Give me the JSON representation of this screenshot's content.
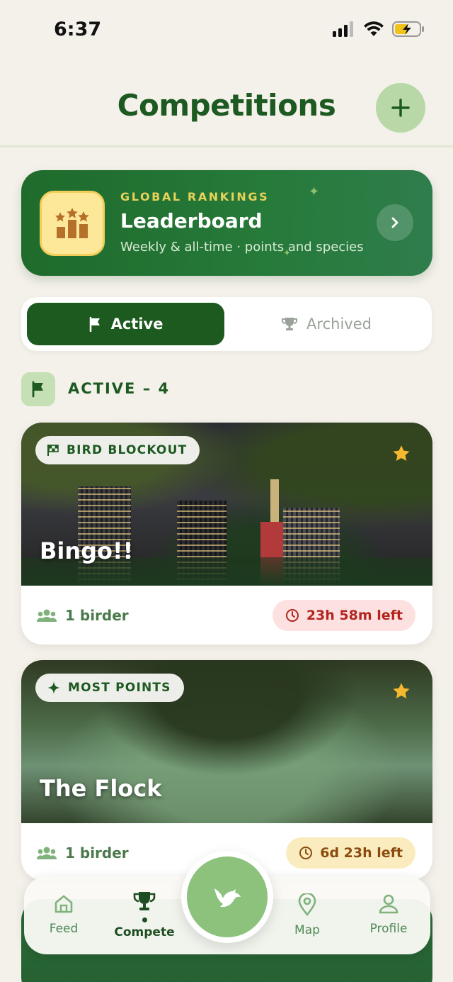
{
  "status_bar": {
    "time": "6:37"
  },
  "header": {
    "title": "Competitions"
  },
  "leaderboard": {
    "eyebrow": "GLOBAL RANKINGS",
    "title": "Leaderboard",
    "subtitle": "Weekly & all-time · points and species"
  },
  "tabs": {
    "active_label": "Active",
    "archived_label": "Archived",
    "selected": "Active"
  },
  "section": {
    "label": "ACTIVE – 4"
  },
  "competitions": [
    {
      "badge": "BIRD BLOCKOUT",
      "title": "Bingo!!",
      "birders": "1 birder",
      "time_left": "23h 58m left",
      "starred": true
    },
    {
      "badge": "MOST POINTS",
      "title": "The Flock",
      "birders": "1 birder",
      "time_left": "6d 23h left",
      "starred": true
    }
  ],
  "nav": {
    "feed": "Feed",
    "compete": "Compete",
    "map": "Map",
    "profile": "Profile",
    "selected": "Compete"
  },
  "colors": {
    "brand_green": "#1d5a21",
    "accent_yellow": "#f5b82e",
    "background": "#f4f1ea"
  }
}
